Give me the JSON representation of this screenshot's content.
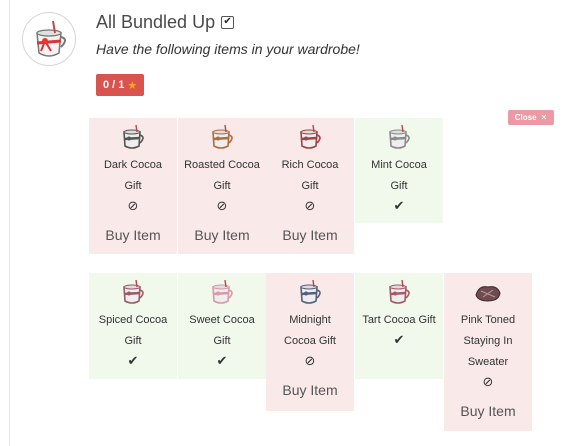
{
  "achievement": {
    "title": "All Bundled Up",
    "title_check": "✔",
    "description": "Have the following items in your wardrobe!",
    "progress": "0 / 1",
    "progress_icon": "star-icon"
  },
  "close_label": "Close",
  "close_icon": "✕",
  "status_owned_icon": "✔",
  "status_missing_icon": "⊘",
  "items": [
    {
      "name_lines": [
        "Dark Cocoa",
        "Gift"
      ],
      "owned": false,
      "buy_label": "Buy Item",
      "mug_color": "#555555"
    },
    {
      "name_lines": [
        "Roasted Cocoa",
        "Gift"
      ],
      "owned": false,
      "buy_label": "Buy Item",
      "mug_color": "#b36a3c"
    },
    {
      "name_lines": [
        "Rich Cocoa",
        "Gift"
      ],
      "owned": false,
      "buy_label": "Buy Item",
      "mug_color": "#a24242"
    },
    {
      "name_lines": [
        "Mint Cocoa",
        "Gift"
      ],
      "owned": true,
      "mug_color": "#8a8a8a"
    },
    {
      "name_lines": [
        "Spiced Cocoa",
        "Gift"
      ],
      "owned": true,
      "mug_color": "#9a5a66"
    },
    {
      "name_lines": [
        "Sweet Cocoa",
        "Gift"
      ],
      "owned": true,
      "mug_color": "#d79aa8"
    },
    {
      "name_lines": [
        "Midnight",
        "Cocoa Gift"
      ],
      "owned": false,
      "buy_label": "Buy Item",
      "mug_color": "#56607d"
    },
    {
      "name_lines": [
        "Tart Cocoa Gift"
      ],
      "owned": true,
      "mug_color": "#a35b6b"
    },
    {
      "name_lines": [
        "Pink Toned",
        "Staying In",
        "Sweater"
      ],
      "owned": false,
      "buy_label": "Buy Item",
      "mug_color": "#6e4b4d"
    }
  ],
  "colors": {
    "owned_bg": "#f1f8ec",
    "missing_bg": "#f9e9e9",
    "badge": "#d9534f",
    "close": "#e99aa5"
  }
}
